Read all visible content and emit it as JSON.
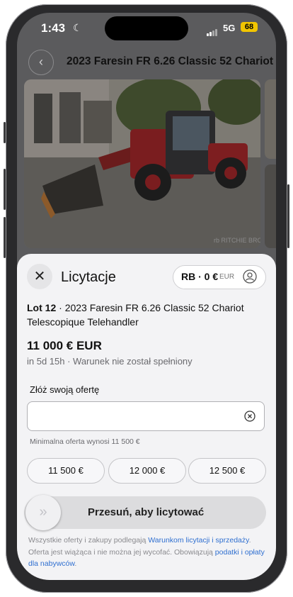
{
  "status_bar": {
    "time": "1:43",
    "network": "5G",
    "battery": "68"
  },
  "header": {
    "back_label": "‹",
    "title": "2023 Faresin FR 6.26 Classic 52 Chariot"
  },
  "gallery": {
    "watermark": "rb RITCHIE BROS."
  },
  "sheet": {
    "close_label": "✕",
    "title": "Licytacje",
    "account": {
      "label": "RB · 0 €",
      "currency": "EUR"
    },
    "lot": {
      "number": "Lot 12",
      "separator": " · ",
      "name": "2023 Faresin FR 6.26 Classic 52 Chariot Telescopique Telehandler"
    },
    "current_bid": "11 000 € EUR",
    "status": "in 5d 15h · Warunek nie został spełniony",
    "bid_label": "Złóż swoją ofertę",
    "bid_value": "",
    "bid_placeholder": "",
    "min_bid": "Minimalna oferta wynosi 11 500 €",
    "quick_bids": [
      "11 500 €",
      "12 000 €",
      "12 500 €"
    ],
    "slider_label": "Przesuń, aby licytować",
    "terms": {
      "part1": "Wszystkie oferty i zakupy podlegają ",
      "link1": "Warunkom licytacji i sprzedaży",
      "part2": ". Oferta jest wiążąca i nie można jej wycofać. Obowiązują ",
      "link2": "podatki i opłaty dla nabywców",
      "part3": "."
    }
  },
  "colors": {
    "link": "#2f6fd0",
    "battery": "#f2c500",
    "sheet_bg": "#f3f3f5"
  }
}
